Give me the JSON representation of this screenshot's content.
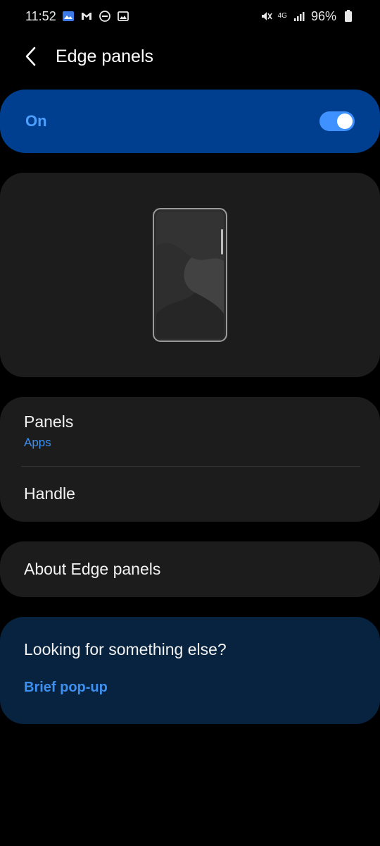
{
  "status_bar": {
    "time": "11:52",
    "battery": "96%",
    "network": "4G"
  },
  "header": {
    "title": "Edge panels"
  },
  "master_switch": {
    "label": "On",
    "state": "on",
    "accent": "#3e91ff"
  },
  "settings": {
    "panels": {
      "title": "Panels",
      "subtitle": "Apps"
    },
    "handle": {
      "title": "Handle"
    },
    "about": {
      "title": "About Edge panels"
    }
  },
  "suggestions": {
    "title": "Looking for something else?",
    "link": "Brief pop-up"
  },
  "colors": {
    "background": "#000000",
    "card": "#1c1c1c",
    "toggle_bar": "#003f8f",
    "suggest_card": "#07233f",
    "link": "#3d8ff0"
  }
}
